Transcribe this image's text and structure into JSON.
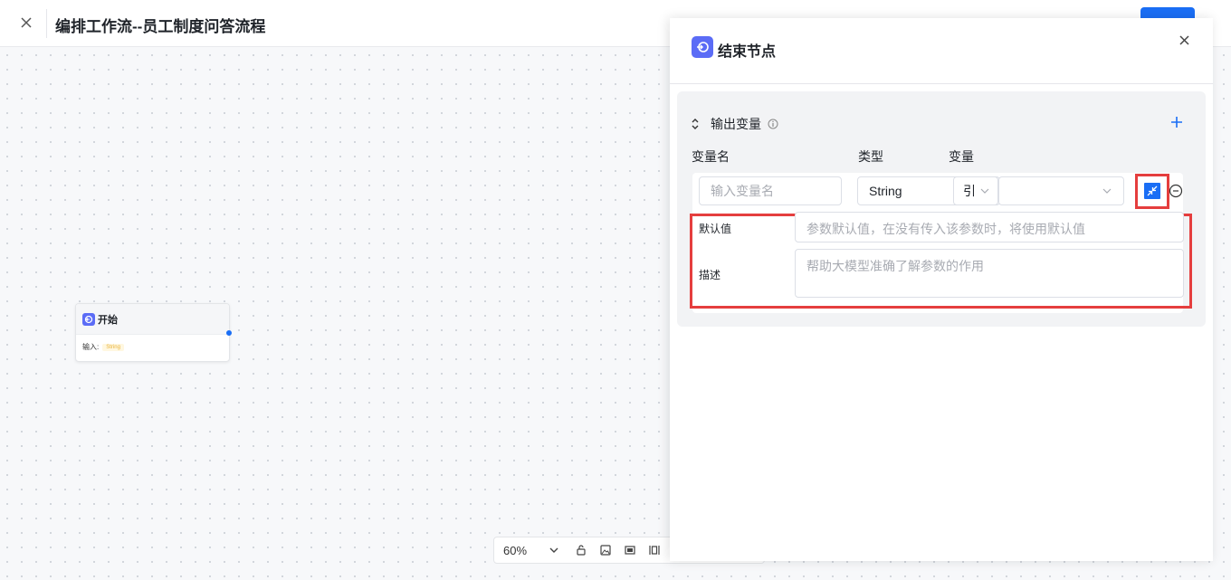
{
  "header": {
    "title": "编排工作流--员工制度问答流程",
    "close_icon": "close-icon",
    "action_button_label": ""
  },
  "canvas": {
    "start_node": {
      "title": "开始",
      "input_label": "输入:",
      "input_type": "String",
      "icon": "start-node-icon"
    },
    "toolbar": {
      "zoom": "60%",
      "icons": [
        "chevron-down-icon",
        "lock-icon",
        "image-icon",
        "fit-view-icon",
        "layout-icon"
      ]
    }
  },
  "panel": {
    "title": "结束节点",
    "icon": "end-node-icon",
    "section": {
      "title": "输出变量",
      "columns": {
        "name": "变量名",
        "type": "类型",
        "variable": "变量"
      },
      "row": {
        "name_placeholder": "输入变量名",
        "type_value": "String",
        "ref_value": "引",
        "var_value": "",
        "default_label": "默认值",
        "default_placeholder": "参数默认值，在没有传入该参数时，将使用默认值",
        "desc_label": "描述",
        "desc_placeholder": "帮助大模型准确了解参数的作用"
      }
    }
  },
  "colors": {
    "accent": "#1a6ef5",
    "node_icon": "#5b6cf6",
    "highlight": "#e53e3e"
  }
}
